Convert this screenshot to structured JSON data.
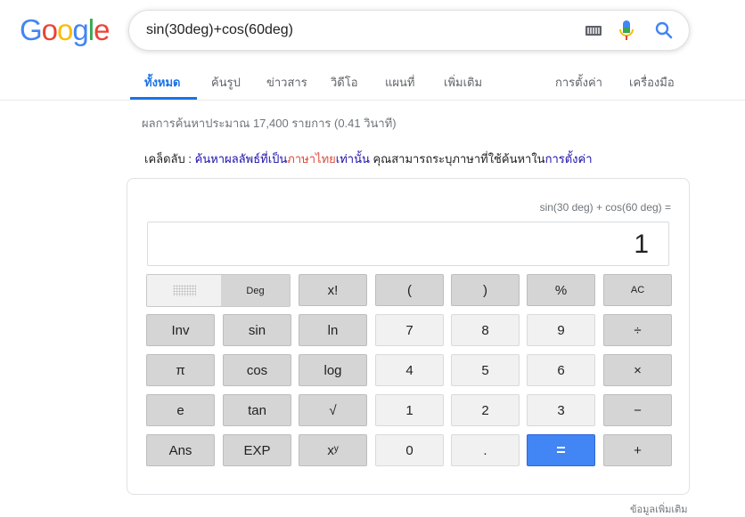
{
  "logo": {
    "letters": [
      "G",
      "o",
      "o",
      "g",
      "l",
      "e"
    ],
    "colors": [
      "#4285f4",
      "#ea4335",
      "#fbbc05",
      "#4285f4",
      "#34a853",
      "#ea4335"
    ]
  },
  "search": {
    "query": "sin(30deg)+cos(60deg)",
    "icons": [
      "keyboard-icon",
      "mic-icon",
      "search-icon"
    ]
  },
  "tabs": [
    {
      "label": "ทั้งหมด",
      "active": true
    },
    {
      "label": "ค้นรูป"
    },
    {
      "label": "ข่าวสาร"
    },
    {
      "label": "วิดีโอ"
    },
    {
      "label": "แผนที่"
    },
    {
      "label": "เพิ่มเติม"
    },
    {
      "label": "การตั้งค่า"
    },
    {
      "label": "เครื่องมือ"
    }
  ],
  "stats": "ผลการค้นหาประมาณ 17,400 รายการ (0.41 วินาที)",
  "tip": {
    "prefix": "เคล็ดลับ :",
    "link1": "ค้นหาผลลัพธ์ที่เป็น",
    "lang": "ภาษาไทย",
    "link1b": "เท่านั้น",
    "middle": " คุณสามารถระบุภาษาที่ใช้ค้นหาใน",
    "link2": "การตั้งค่า"
  },
  "calculator": {
    "expression": "sin(30 deg) + cos(60 deg) =",
    "result": "1",
    "angle_mode": "Deg",
    "keys": {
      "fact": "x!",
      "lparen": "(",
      "rparen": ")",
      "percent": "%",
      "clear": "AC",
      "inv": "Inv",
      "sin": "sin",
      "ln": "ln",
      "d7": "7",
      "d8": "8",
      "d9": "9",
      "div": "÷",
      "pi": "π",
      "cos": "cos",
      "log": "log",
      "d4": "4",
      "d5": "5",
      "d6": "6",
      "mul": "×",
      "e": "e",
      "tan": "tan",
      "sqrt": "√",
      "d1": "1",
      "d2": "2",
      "d3": "3",
      "sub": "−",
      "ans": "Ans",
      "exp": "EXP",
      "pow": "xʸ",
      "d0": "0",
      "dot": ".",
      "eq": "=",
      "add": "+"
    }
  },
  "more_info": "ข้อมูลเพิ่มเติม"
}
